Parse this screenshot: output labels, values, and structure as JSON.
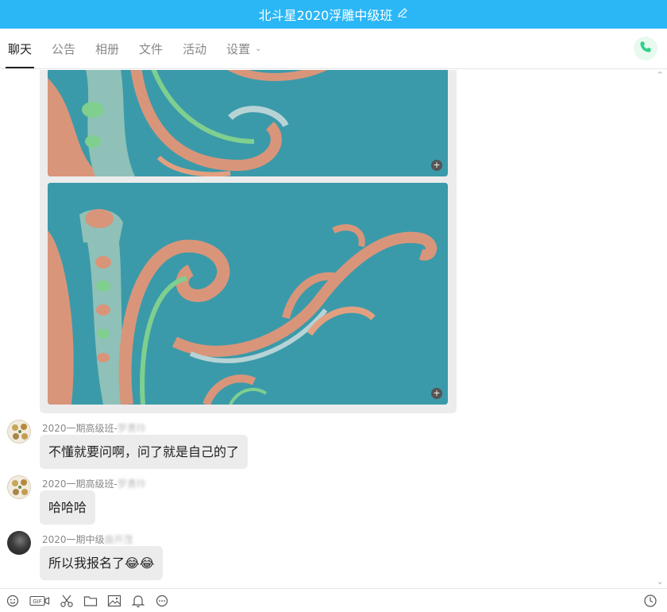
{
  "window": {
    "title": "北斗星2020浮雕中级班",
    "edit_icon": "pencil-icon"
  },
  "tabs": [
    {
      "label": "聊天",
      "active": true
    },
    {
      "label": "公告"
    },
    {
      "label": "相册"
    },
    {
      "label": "文件"
    },
    {
      "label": "活动"
    },
    {
      "label": "设置"
    }
  ],
  "call_button": {
    "icon": "phone-icon",
    "color": "#2fd08a"
  },
  "messages": [
    {
      "sender_group": "2020一期高级班-",
      "sender_name": "罗勇玲",
      "text": "不懂就要问啊，问了就是自己的了"
    },
    {
      "sender_group": "2020一期高级班-",
      "sender_name": "罗勇玲",
      "text": "哈哈哈"
    },
    {
      "sender_group": "2020一期中级",
      "sender_name": "曲开茂",
      "text": "所以我报名了😂😂"
    }
  ],
  "toolbar": {
    "icons": [
      "emoji-icon",
      "gif-icon",
      "scissors-icon",
      "folder-icon",
      "image-icon",
      "bell-icon",
      "more-icon"
    ],
    "gif_label": "GIF",
    "history_icon": "clock-icon"
  },
  "colors": {
    "title_bar": "#2bb7f5",
    "bubble": "#ececec",
    "carving_bg": "#3a9aaa"
  }
}
